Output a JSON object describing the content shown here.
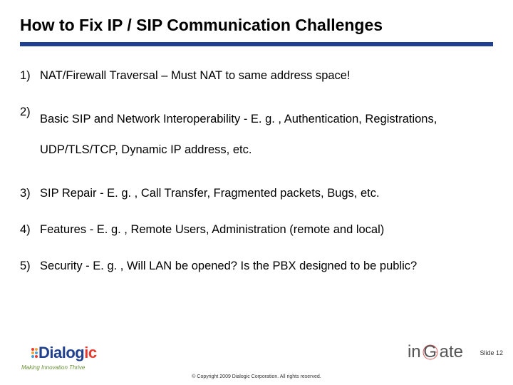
{
  "title": "How to Fix IP / SIP Communication Challenges",
  "items": [
    {
      "num": "1)",
      "text": "NAT/Firewall Traversal – Must NAT to same address space!"
    },
    {
      "num": "2)",
      "text": "Basic SIP and Network Interoperability - E. g. , Authentication, Registrations, UDP/TLS/TCP, Dynamic IP address, etc."
    },
    {
      "num": "3)",
      "text": "SIP Repair - E. g. , Call Transfer, Fragmented packets, Bugs, etc."
    },
    {
      "num": "4)",
      "text": "Features - E. g. , Remote Users, Administration (remote and local)"
    },
    {
      "num": "5)",
      "text": "Security - E. g. , Will LAN be opened? Is the PBX designed to be public?"
    }
  ],
  "logo": {
    "dialogic_prefix": "Dialog",
    "dialogic_suffix": "ic",
    "tagline": "Making Innovation Thrive",
    "ingate_left": "in",
    "ingate_g": "G",
    "ingate_right": "ate"
  },
  "slide_label": "Slide 12",
  "copyright": "© Copyright 2009 Dialogic Corporation. All rights reserved."
}
